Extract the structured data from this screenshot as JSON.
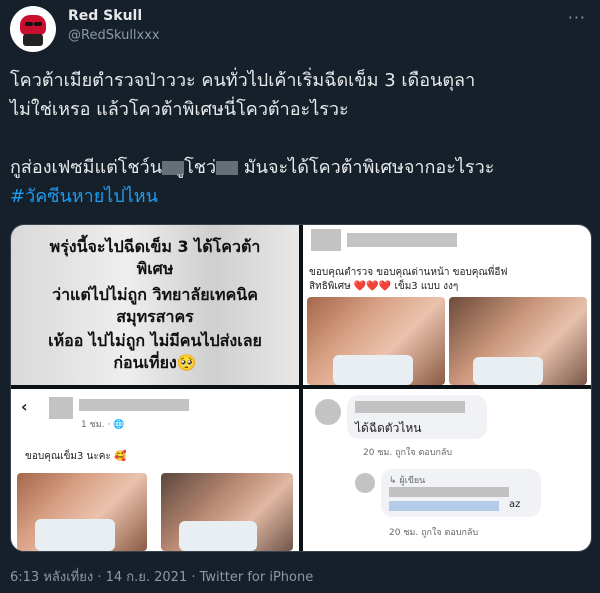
{
  "user": {
    "name": "Red Skull",
    "handle": "@RedSkullxxx"
  },
  "tweet": {
    "line1": "โควต้าเมียตำรวจป่าววะ คนทั่วไปเค้าเริ่มฉีดเข็ม 3 เดือนตุลา",
    "line2": "ไม่ใช่เหรอ แล้วโควต้าพิเศษนี่โควต้าอะไรวะ",
    "line3a": "กูส่องเฟซมีแต่โชว์น",
    "line3b": "ูโชว่",
    "line3c": "มันจะได้โควต้าพิเศษจากอะไรวะ",
    "hashtag": "#วัคซีนหายไปไหน"
  },
  "media": {
    "panel1": {
      "l1": "พรุ่งนี้จะไปฉีดเข็ม 3  ได้โควต้า",
      "l2": "พิเศษ",
      "l3": "ว่าแต่ไปไม่ถูก วิทยาลัยเทคนิค",
      "l4": "สมุทรสาคร",
      "l5": "เห้ออ ไปไม่ถูก ไม่มีคนไปส่งเลย",
      "l6": "ก่อนเที่ยง🥺"
    },
    "panel2": {
      "caption1": "ขอบคุณตำรวจ ขอบคุณด่านหน้า ขอบคุณพี่อีฟ",
      "caption2": "สิทธิพิเศษ ❤️❤️❤️ เข็ม3 แบบ งงๆ"
    },
    "panel3": {
      "back": "‹",
      "time": "1 ชม. · 🌐",
      "caption": "ขอบคุณเข็ม3 นะคะ 🥰"
    },
    "panel4": {
      "comment": "ได้ฉีดตัวไหน",
      "meta1": "20 ชม.     ถูกใจ   ตอบกลับ",
      "reply_label": "↳ ผู้เขียน",
      "reply_text": "az",
      "meta2": "20 ชม.     ถูกใจ   ตอบกลับ"
    }
  },
  "footer": {
    "meta": "6:13 หลังเที่ยง · 14 ก.ย. 2021 · Twitter for iPhone"
  },
  "icons": [
    "red-skull-avatar-icon",
    "more-options-icon"
  ]
}
